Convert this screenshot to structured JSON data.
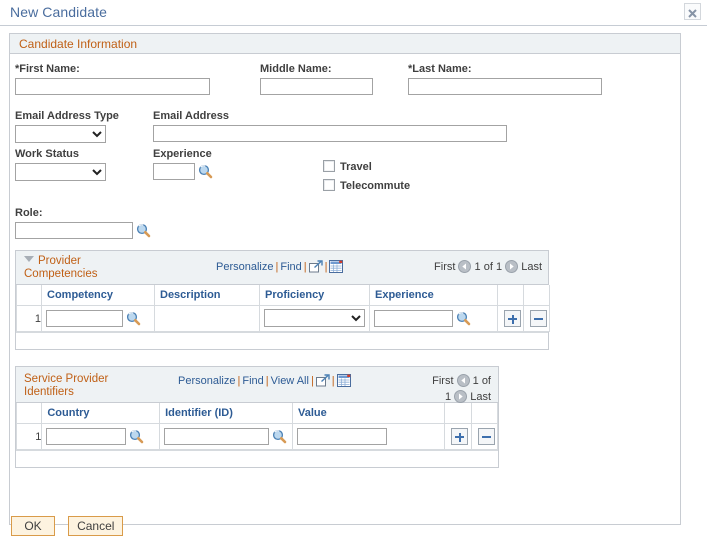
{
  "page": {
    "title": "New Candidate",
    "close_icon": "close-icon"
  },
  "group": {
    "header": "Candidate Information"
  },
  "fields": {
    "first_name": {
      "label": "*First Name:",
      "value": "",
      "placeholder": ""
    },
    "middle_name": {
      "label": "Middle Name:",
      "value": "",
      "placeholder": ""
    },
    "last_name": {
      "label": "*Last Name:",
      "value": "",
      "placeholder": ""
    },
    "email_address_type": {
      "label": "Email Address Type",
      "value": "",
      "options": [
        ""
      ]
    },
    "email_address": {
      "label": "Email Address",
      "value": "",
      "placeholder": ""
    },
    "work_status": {
      "label": "Work Status",
      "value": "",
      "options": [
        ""
      ]
    },
    "experience": {
      "label": "Experience",
      "value": "",
      "lookup_icon": "magnifier-icon"
    },
    "role": {
      "label": "Role:",
      "value": "",
      "lookup_icon": "magnifier-icon"
    },
    "travel": {
      "label": "Travel",
      "checked": false
    },
    "telecommute": {
      "label": "Telecommute",
      "checked": false
    }
  },
  "competencies_grid": {
    "title": "Provider Competencies",
    "links": {
      "personalize": "Personalize",
      "find": "Find",
      "expand_icon": "expand-window-icon",
      "download_icon": "download-spreadsheet-icon"
    },
    "nav": {
      "first": "First",
      "prev_icon": "previous-arrow-icon",
      "counter": "1 of 1",
      "next_icon": "next-arrow-icon",
      "last": "Last"
    },
    "columns": [
      "",
      "Competency",
      "Description",
      "Proficiency",
      "Experience",
      "",
      ""
    ],
    "rows": [
      {
        "num": "1",
        "competency": "",
        "description": "",
        "proficiency": "",
        "proficiency_options": [
          ""
        ],
        "experience": "",
        "add_label": "+",
        "remove_label": "-"
      }
    ]
  },
  "identifiers_grid": {
    "title": "Service Provider Identifiers",
    "links": {
      "personalize": "Personalize",
      "find": "Find",
      "view_all": "View All",
      "expand_icon": "expand-window-icon",
      "download_icon": "download-spreadsheet-icon"
    },
    "nav": {
      "first": "First",
      "prev_icon": "previous-arrow-icon",
      "counter": "1 of",
      "counter2": "1",
      "next_icon": "next-arrow-icon",
      "last": "Last"
    },
    "columns": [
      "",
      "Country",
      "Identifier (ID)",
      "Value",
      "",
      ""
    ],
    "rows": [
      {
        "num": "1",
        "country": "",
        "identifier": "",
        "value": "",
        "add_label": "+",
        "remove_label": "-"
      }
    ]
  },
  "buttons": {
    "ok": "OK",
    "cancel": "Cancel"
  },
  "colors": {
    "title_blue": "#4a6d9e",
    "section_orange": "#c06016",
    "link_blue": "#2d5b94",
    "panel_bg": "#eef2f4",
    "border": "#c8ccd2",
    "button_border": "#d99b49",
    "button_bg": "#fdf3e0",
    "plusminus_blue": "#3d6fad"
  }
}
